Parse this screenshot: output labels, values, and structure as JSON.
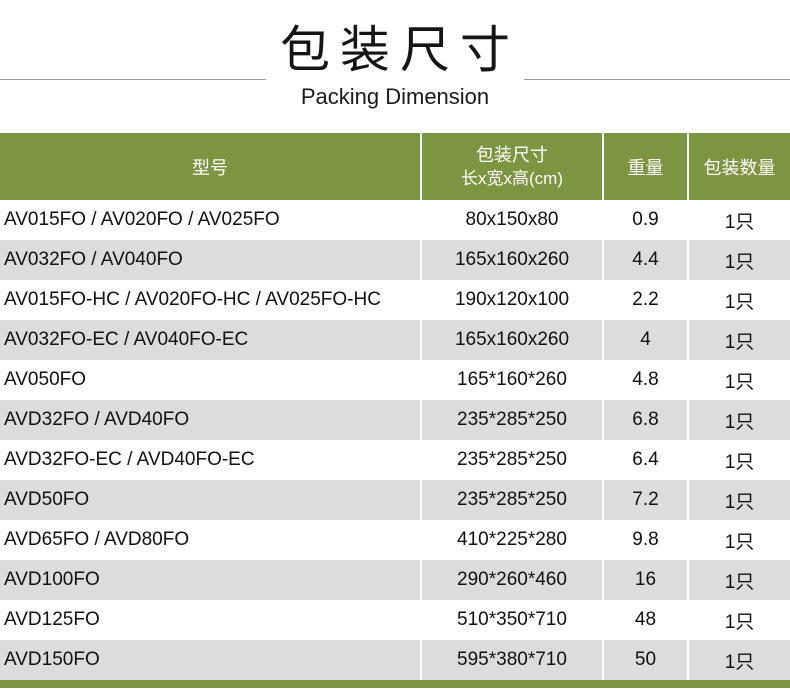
{
  "title": "包装尺寸",
  "subtitle": "Packing Dimension",
  "colors": {
    "header_green": "#7b9540",
    "stripe_gray": "#dcdcdc",
    "header_text": "#ffffff",
    "body_text": "#111111"
  },
  "table": {
    "headers": {
      "model": "型号",
      "size_line1": "包装尺寸",
      "size_line2": "长x宽x高(cm)",
      "weight": "重量",
      "quantity": "包装数量"
    },
    "rows": [
      {
        "model": "AV015FO / AV020FO / AV025FO",
        "size": "80x150x80",
        "weight": "0.9",
        "quantity": "1只"
      },
      {
        "model": "AV032FO / AV040FO",
        "size": "165x160x260",
        "weight": "4.4",
        "quantity": "1只"
      },
      {
        "model": "AV015FO-HC / AV020FO-HC / AV025FO-HC",
        "size": "190x120x100",
        "weight": "2.2",
        "quantity": "1只"
      },
      {
        "model": "AV032FO-EC / AV040FO-EC",
        "size": "165x160x260",
        "weight": "4",
        "quantity": "1只"
      },
      {
        "model": "AV050FO",
        "size": "165*160*260",
        "weight": "4.8",
        "quantity": "1只"
      },
      {
        "model": "AVD32FO / AVD40FO",
        "size": "235*285*250",
        "weight": "6.8",
        "quantity": "1只"
      },
      {
        "model": "AVD32FO-EC / AVD40FO-EC",
        "size": "235*285*250",
        "weight": "6.4",
        "quantity": "1只"
      },
      {
        "model": "AVD50FO",
        "size": "235*285*250",
        "weight": "7.2",
        "quantity": "1只"
      },
      {
        "model": "AVD65FO / AVD80FO",
        "size": "410*225*280",
        "weight": "9.8",
        "quantity": "1只"
      },
      {
        "model": "AVD100FO",
        "size": "290*260*460",
        "weight": "16",
        "quantity": "1只"
      },
      {
        "model": "AVD125FO",
        "size": "510*350*710",
        "weight": "48",
        "quantity": "1只"
      },
      {
        "model": "AVD150FO",
        "size": "595*380*710",
        "weight": "50",
        "quantity": "1只"
      }
    ]
  }
}
